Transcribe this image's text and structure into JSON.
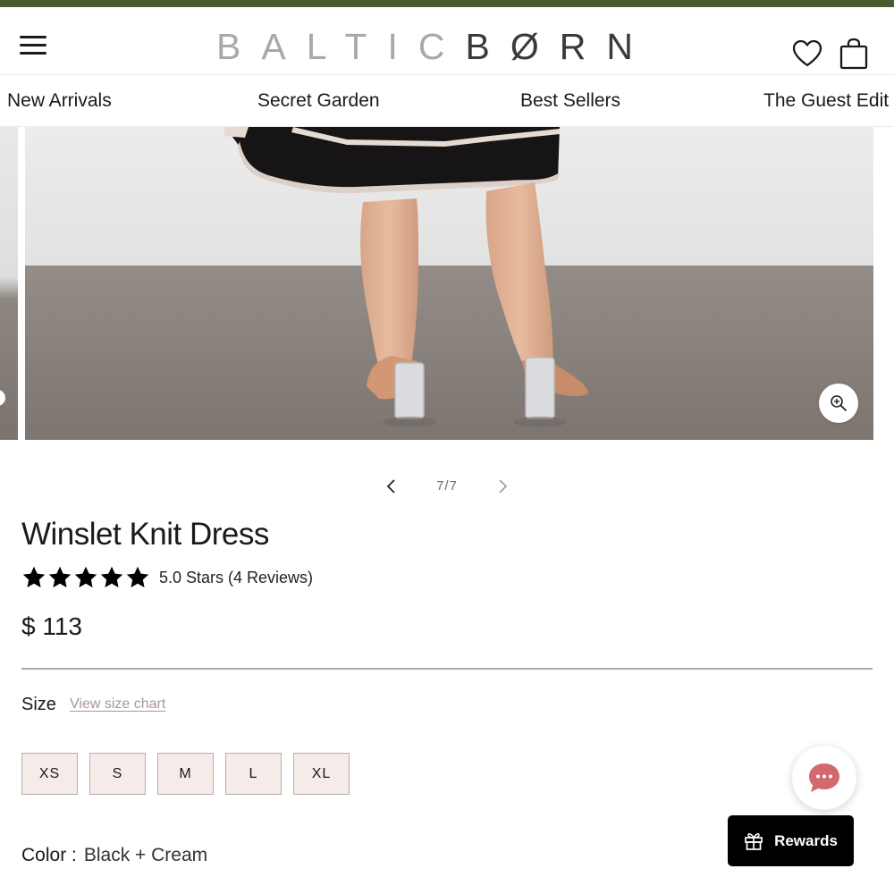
{
  "colors": {
    "topbar": "#4a5a2f",
    "accent_link": "#a8959b",
    "divider": "#b0a6a9",
    "size_bg": "#f5ebe8",
    "rewards_bg": "#000000",
    "chat_icon": "#d2696e",
    "star": "#000000"
  },
  "header": {
    "logo_part1": "BALTIC",
    "logo_part2": "BØRN",
    "menu_icon": "hamburger-icon",
    "wishlist_icon": "heart-icon",
    "cart_icon": "shopping-bag-icon"
  },
  "nav": {
    "items": [
      {
        "label": "New Arrivals"
      },
      {
        "label": "Secret Garden"
      },
      {
        "label": "Best Sellers"
      },
      {
        "label": "The Guest Edit"
      }
    ]
  },
  "gallery": {
    "counter": "7/7",
    "zoom_icon": "zoom-in-icon"
  },
  "product": {
    "title": "Winslet Knit Dress",
    "rating_value": 5,
    "rating_max": 5,
    "rating_text": "5.0 Stars (4 Reviews)",
    "price": "$ 113",
    "size_label": "Size",
    "size_chart_label": "View size chart",
    "sizes": [
      "XS",
      "S",
      "M",
      "L",
      "XL"
    ],
    "color_label": "Color :",
    "color_value": "Black + Cream"
  },
  "widgets": {
    "chat_icon": "chat-bubble-icon",
    "rewards_label": "Rewards",
    "rewards_icon": "gift-icon"
  }
}
